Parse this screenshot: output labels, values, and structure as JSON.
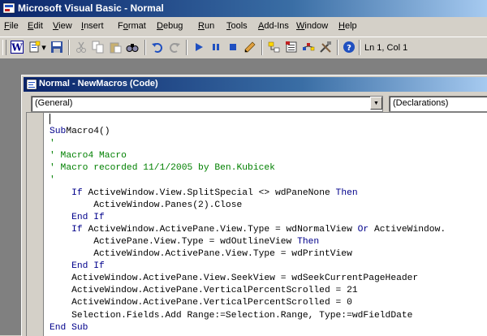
{
  "app": {
    "title": "Microsoft Visual Basic - Normal"
  },
  "menu": [
    {
      "label": "File",
      "u": "F",
      "rest": "ile"
    },
    {
      "label": "Edit",
      "u": "E",
      "rest": "dit"
    },
    {
      "label": "View",
      "u": "V",
      "rest": "iew"
    },
    {
      "label": "Insert",
      "u": "I",
      "rest": "nsert"
    },
    {
      "label": "Format",
      "pre": "F",
      "u": "o",
      "rest": "rmat"
    },
    {
      "label": "Debug",
      "u": "D",
      "rest": "ebug"
    },
    {
      "label": "Run",
      "u": "R",
      "rest": "un"
    },
    {
      "label": "Tools",
      "u": "T",
      "rest": "ools"
    },
    {
      "label": "Add-Ins",
      "u": "A",
      "rest": "dd-Ins"
    },
    {
      "label": "Window",
      "u": "W",
      "rest": "indow"
    },
    {
      "label": "Help",
      "u": "H",
      "rest": "elp"
    }
  ],
  "toolbar": {
    "icons": [
      "word-icon",
      "insert-module-icon",
      "save-icon",
      "cut-icon",
      "copy-icon",
      "paste-icon",
      "find-icon",
      "undo-icon",
      "redo-icon",
      "run-icon",
      "break-icon",
      "reset-icon",
      "design-mode-icon",
      "project-explorer-icon",
      "properties-icon",
      "object-browser-icon",
      "toolbox-icon",
      "help-icon"
    ],
    "position": "Ln 1, Col 1"
  },
  "code_window": {
    "title": "Normal - NewMacros (Code)",
    "object_combo": "(General)",
    "procedure_combo": "(Declarations)"
  },
  "code_lines": [
    {
      "cursor": true
    },
    {
      "parts": [
        [
          "kw",
          "Sub"
        ],
        [
          "",
          "Macro4()"
        ]
      ]
    },
    {
      "parts": [
        [
          "cm",
          "'"
        ]
      ]
    },
    {
      "parts": [
        [
          "cm",
          "' Macro4 Macro"
        ]
      ]
    },
    {
      "parts": [
        [
          "cm",
          "' Macro recorded 11/1/2005 by Ben.Kubicek"
        ]
      ]
    },
    {
      "parts": [
        [
          "cm",
          "'"
        ]
      ]
    },
    {
      "parts": [
        [
          "",
          "    "
        ],
        [
          "kw",
          "If"
        ],
        [
          "",
          " ActiveWindow.View.SplitSpecial <> wdPaneNone "
        ],
        [
          "kw",
          "Then"
        ]
      ]
    },
    {
      "parts": [
        [
          "",
          "        ActiveWindow.Panes(2).Close"
        ]
      ]
    },
    {
      "parts": [
        [
          "",
          "    "
        ],
        [
          "kw",
          "End If"
        ]
      ]
    },
    {
      "parts": [
        [
          "",
          "    "
        ],
        [
          "kw",
          "If"
        ],
        [
          "",
          " ActiveWindow.ActivePane.View.Type = wdNormalView "
        ],
        [
          "kw",
          "Or"
        ],
        [
          "",
          " ActiveWindow."
        ]
      ]
    },
    {
      "parts": [
        [
          "",
          "        ActivePane.View.Type = wdOutlineView "
        ],
        [
          "kw",
          "Then"
        ]
      ]
    },
    {
      "parts": [
        [
          "",
          "        ActiveWindow.ActivePane.View.Type = wdPrintView"
        ]
      ]
    },
    {
      "parts": [
        [
          "",
          "    "
        ],
        [
          "kw",
          "End If"
        ]
      ]
    },
    {
      "parts": [
        [
          "",
          "    ActiveWindow.ActivePane.View.SeekView = wdSeekCurrentPageHeader"
        ]
      ]
    },
    {
      "parts": [
        [
          "",
          "    ActiveWindow.ActivePane.VerticalPercentScrolled = 21"
        ]
      ]
    },
    {
      "parts": [
        [
          "",
          "    ActiveWindow.ActivePane.VerticalPercentScrolled = 0"
        ]
      ]
    },
    {
      "parts": [
        [
          "",
          "    Selection.Fields.Add Range:=Selection.Range, Type:=wdFieldDate"
        ]
      ]
    },
    {
      "parts": [
        [
          "kw",
          "End Sub"
        ]
      ]
    }
  ],
  "colors": {
    "keyword": "#00008b",
    "comment": "#008000",
    "titlebar": "#0a246a"
  }
}
